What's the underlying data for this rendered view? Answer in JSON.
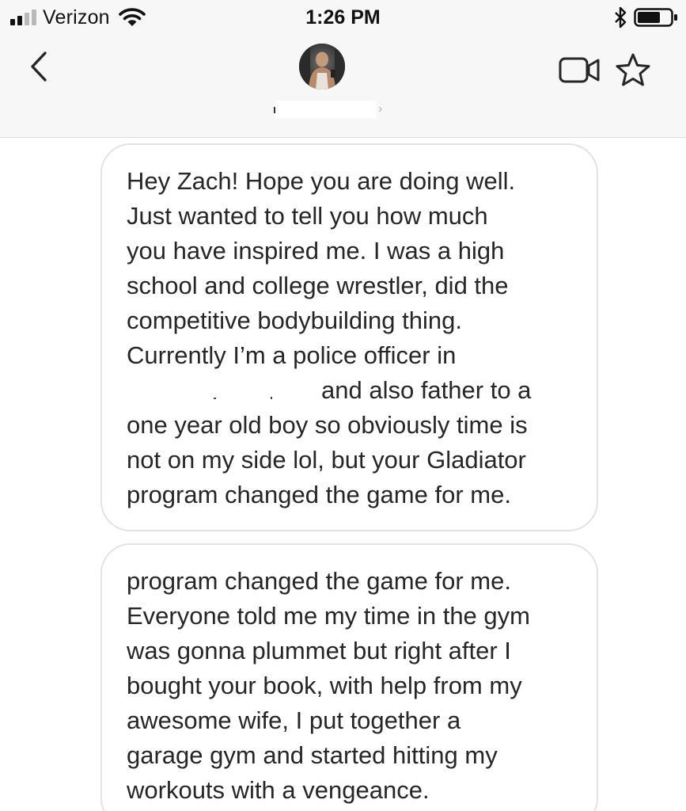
{
  "status_bar": {
    "carrier": "Verizon",
    "time": "1:26 PM",
    "icons": [
      "signal-icon",
      "wifi-icon",
      "bluetooth-icon",
      "battery-icon"
    ]
  },
  "nav": {
    "icons": [
      "back-chevron-icon",
      "video-call-icon",
      "star-icon",
      "chevron-right-icon"
    ],
    "title_chevron": "›"
  },
  "messages": [
    {
      "lines": [
        "Hey Zach! Hope you are doing well.",
        "Just wanted to tell you how much",
        "you have inspired me. I was a high",
        "school and college wrestler, did the",
        "competitive bodybuilding thing.",
        "Currently I’m a police officer in",
        "and also father to a",
        "one year old boy so obviously time is",
        "not on my side lol, but your Gladiator",
        "program changed the game for me."
      ]
    },
    {
      "lines": [
        "program changed the game for me.",
        "Everyone told me my time in the gym",
        "was gonna plummet but right after I",
        "bought your book, with help from my",
        "awesome wife, I put together a",
        "garage gym and started hitting my",
        "workouts with a vengeance."
      ]
    }
  ],
  "colors": {
    "header_bg": "#f7f7f7",
    "bubble_border": "#e3e3e3",
    "text": "#262626"
  }
}
